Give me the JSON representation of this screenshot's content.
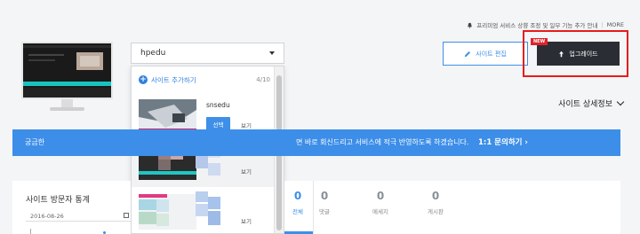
{
  "notice": {
    "text": "프리미엄 서비스 상향 조정 및 일부 기능 추가 안내",
    "more_label": "MORE",
    "separator": "|"
  },
  "site_selector": {
    "selected": "hpedu",
    "add_label": "사이트 추가하기",
    "count": "4/10",
    "sites": [
      {
        "name": "snsedu",
        "select_label": "선택",
        "view_label": "보기"
      },
      {
        "name": "",
        "view_label": "보기"
      },
      {
        "name": "",
        "view_label": "보기"
      }
    ]
  },
  "actions": {
    "edit_label": "사이트 편집",
    "upgrade_label": "업그레이드",
    "new_badge": "NEW"
  },
  "detail_link": "사이트 상세정보",
  "banner": {
    "left_text": "궁금한",
    "right_text": "면 바로 회신드리고 서비스에 적극 반영하도록 하겠습니다.",
    "cta": "1:1 문의하기 ›"
  },
  "stats": {
    "title": "사이트 방문자 통계",
    "date": "2016-08-26"
  },
  "tabs": [
    {
      "count": "0",
      "label": "전체"
    },
    {
      "count": "0",
      "label": "댓글"
    },
    {
      "count": "0",
      "label": "메세지"
    },
    {
      "count": "0",
      "label": "게시판"
    }
  ],
  "colors": {
    "accent": "#3d8ee8",
    "highlight": "#e81b1b",
    "upgrade_bg": "#2a2e34"
  }
}
